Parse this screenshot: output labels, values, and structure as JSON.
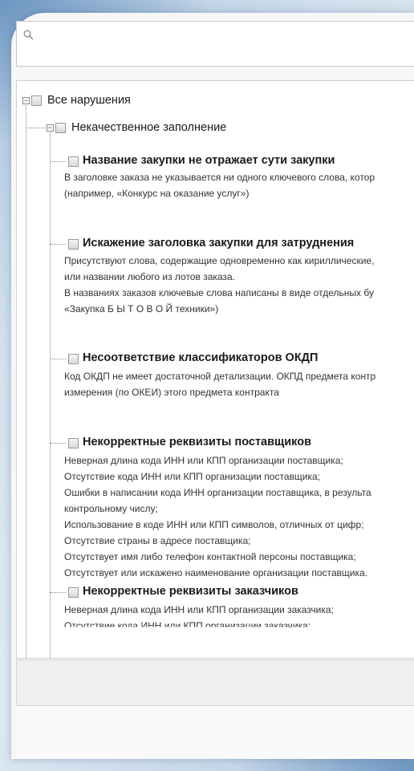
{
  "search": {
    "placeholder": "",
    "value": ""
  },
  "tree": {
    "root": {
      "label": "Все нарушения"
    },
    "group": {
      "label": "Некачественное заполнение"
    },
    "items": [
      {
        "title": "Название закупки не отражает сути закупки",
        "lines": [
          "В заголовке заказа не указывается ни одного ключевого слова, котор",
          "(например, «Конкурс на оказание услуг»)"
        ]
      },
      {
        "title": "Искажение заголовка закупки для затруднения",
        "lines": [
          "Присутствуют слова, содержащие одновременно как кириллические,",
          "или названии любого из лотов заказа.",
          "В названиях заказов ключевые слова написаны в виде отдельных бу",
          "«Закупка Б Ы Т О В О Й техники»)"
        ]
      },
      {
        "title": "Несоответствие классификаторов ОКДП",
        "lines": [
          "Код ОКДП не имеет достаточной детализации. ОКПД предмета контр",
          "измерения (по ОКЕИ) этого предмета контракта"
        ]
      },
      {
        "title": "Некорректные реквизиты поставщиков",
        "lines": [
          "Неверная длина кода ИНН или КПП организации поставщика;",
          "Отсутствие кода ИНН или КПП организации поставщика;",
          "Ошибки в написании кода ИНН организации поставщика, в результа",
          "контрольному числу;",
          "Использование в коде ИНН или КПП символов, отличных от цифр;",
          "Отсутствие страны в адресе поставщика;",
          "Отсутствует имя либо телефон контактной персоны поставщика;",
          "Отсутствует или искажено наименование организации поставщика."
        ]
      },
      {
        "title": "Некорректные реквизиты заказчиков",
        "lines": [
          "Неверная длина кода ИНН или КПП организации заказчика;",
          "Отсутствие кода ИНН или КПП организации заказчика;"
        ]
      }
    ]
  }
}
